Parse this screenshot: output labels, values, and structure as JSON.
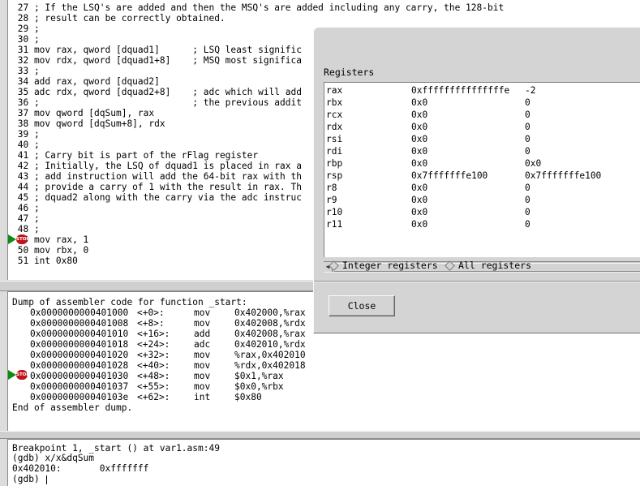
{
  "source": {
    "lines": [
      " 27 ; If the LSQ's are added and then the MSQ's are added including any carry, the 128-bit",
      " 28 ; result can be correctly obtained.",
      " 29 ;",
      " 30 ;",
      " 31 mov rax, qword [dquad1]      ; LSQ least signific",
      " 32 mov rdx, qword [dquad1+8]    ; MSQ most significa",
      " 33 ;",
      " 34 add rax, qword [dquad2]",
      " 35 adc rdx, qword [dquad2+8]    ; adc which will add",
      " 36 ;                            ; the previous addit",
      " 37 mov qword [dqSum], rax",
      " 38 mov qword [dqSum+8], rdx",
      " 39 ;",
      " 40 ;",
      " 41 ; Carry bit is part of the rFlag register",
      " 42 ; Initially, the LSQ of dquad1 is placed in rax a",
      " 43 ; add instruction will add the 64-bit rax with th",
      " 44 ; provide a carry of 1 with the result in rax. Th",
      " 45 ; dquad2 along with the carry via the adc instruc",
      " 46 ;",
      " 47 ;",
      " 48 ;",
      " 49 mov rax, 1",
      " 50 mov rbx, 0",
      " 51 int 0x80"
    ],
    "breakpoint_line": "49"
  },
  "asm": {
    "header": "Dump of assembler code for function _start:",
    "rows": [
      {
        "addr": "0x0000000000401000",
        "off": "<+0>:",
        "op": "mov",
        "args": "0x402000,%rax"
      },
      {
        "addr": "0x0000000000401008",
        "off": "<+8>:",
        "op": "mov",
        "args": "0x402008,%rdx"
      },
      {
        "addr": "0x0000000000401010",
        "off": "<+16>:",
        "op": "add",
        "args": "0x402008,%rax"
      },
      {
        "addr": "0x0000000000401018",
        "off": "<+24>:",
        "op": "adc",
        "args": "0x402010,%rdx"
      },
      {
        "addr": "0x0000000000401020",
        "off": "<+32>:",
        "op": "mov",
        "args": "%rax,0x402010"
      },
      {
        "addr": "0x0000000000401028",
        "off": "<+40>:",
        "op": "mov",
        "args": "%rdx,0x402018"
      },
      {
        "addr": "0x0000000000401030",
        "off": "<+48>:",
        "op": "mov",
        "args": "$0x1,%rax"
      },
      {
        "addr": "0x0000000000401037",
        "off": "<+55>:",
        "op": "mov",
        "args": "$0x0,%rbx"
      },
      {
        "addr": "0x000000000040103e",
        "off": "<+62>:",
        "op": "int",
        "args": "$0x80"
      }
    ],
    "footer": "End of assembler dump."
  },
  "console": {
    "lines": [
      "Breakpoint 1, _start () at var1.asm:49",
      "(gdb) x/x&dqSum",
      "0x402010:       0xfffffff"
    ],
    "prompt": "(gdb) "
  },
  "breakpoint": {
    "stop_label": "STOP"
  },
  "registers_dialog": {
    "title": "Registers",
    "registers": [
      {
        "name": "rax",
        "hex": "0xfffffffffffffffe",
        "value": "-2"
      },
      {
        "name": "rbx",
        "hex": "0x0",
        "value": "0"
      },
      {
        "name": "rcx",
        "hex": "0x0",
        "value": "0"
      },
      {
        "name": "rdx",
        "hex": "0x0",
        "value": "0"
      },
      {
        "name": "rsi",
        "hex": "0x0",
        "value": "0"
      },
      {
        "name": "rdi",
        "hex": "0x0",
        "value": "0"
      },
      {
        "name": "rbp",
        "hex": "0x0",
        "value": "0x0"
      },
      {
        "name": "rsp",
        "hex": "0x7fffffffe100",
        "value": "0x7fffffffe100"
      },
      {
        "name": "r8",
        "hex": "0x0",
        "value": "0"
      },
      {
        "name": "r9",
        "hex": "0x0",
        "value": "0"
      },
      {
        "name": "r10",
        "hex": "0x0",
        "value": "0"
      },
      {
        "name": "r11",
        "hex": "0x0",
        "value": "0"
      }
    ],
    "radio_integer": "Integer registers",
    "radio_all": "All registers",
    "close_label": "Close"
  },
  "colors": {
    "stop_red": "#c0141b",
    "arrow_green": "#0e8a17"
  }
}
